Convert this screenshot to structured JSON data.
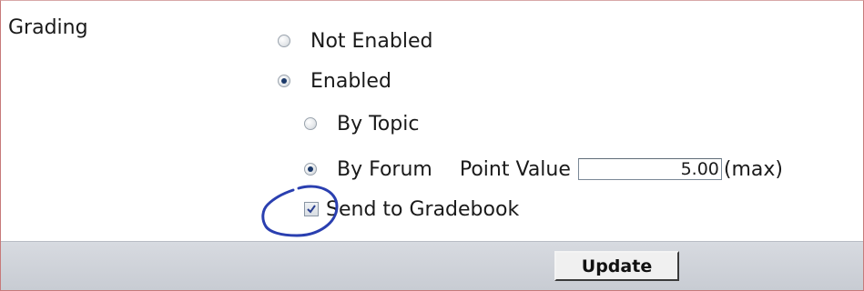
{
  "section": {
    "label": "Grading"
  },
  "grading_options": [
    {
      "label": "Not Enabled",
      "selected": false
    },
    {
      "label": "Enabled",
      "selected": true
    }
  ],
  "scope_options": [
    {
      "label": "By Topic",
      "selected": false
    },
    {
      "label": "By Forum",
      "selected": true
    }
  ],
  "point_value": {
    "label": "Point Value",
    "value": "5.00",
    "suffix": "(max)"
  },
  "gradebook": {
    "label": "Send to Gradebook",
    "checked": true
  },
  "footer": {
    "update_label": "Update"
  },
  "colors": {
    "frame_border": "#c77a7a",
    "footer_bg": "#cfd2d8",
    "radio_dot": "#1d3a6a",
    "checkmark": "#2a3f8f",
    "annotation": "#2a3fb0"
  }
}
